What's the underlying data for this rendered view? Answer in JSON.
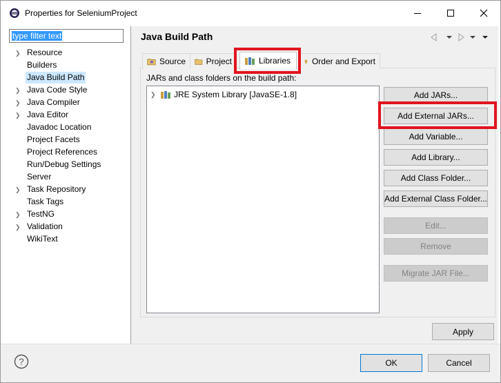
{
  "window": {
    "title": "Properties for SeleniumProject",
    "minimize_icon": "minimize-icon",
    "maximize_icon": "maximize-icon",
    "close_icon": "close-icon"
  },
  "filter": {
    "value": "type filter text"
  },
  "tree": {
    "items": [
      {
        "label": "Resource",
        "expandable": true
      },
      {
        "label": "Builders",
        "expandable": false
      },
      {
        "label": "Java Build Path",
        "expandable": false,
        "selected": true
      },
      {
        "label": "Java Code Style",
        "expandable": true
      },
      {
        "label": "Java Compiler",
        "expandable": true
      },
      {
        "label": "Java Editor",
        "expandable": true
      },
      {
        "label": "Javadoc Location",
        "expandable": false
      },
      {
        "label": "Project Facets",
        "expandable": false
      },
      {
        "label": "Project References",
        "expandable": false
      },
      {
        "label": "Run/Debug Settings",
        "expandable": false
      },
      {
        "label": "Server",
        "expandable": false
      },
      {
        "label": "Task Repository",
        "expandable": true
      },
      {
        "label": "Task Tags",
        "expandable": false
      },
      {
        "label": "TestNG",
        "expandable": true
      },
      {
        "label": "Validation",
        "expandable": true
      },
      {
        "label": "WikiText",
        "expandable": false
      }
    ]
  },
  "page": {
    "title": "Java Build Path"
  },
  "tabs": [
    {
      "label": "Source",
      "icon": "source-folder-icon"
    },
    {
      "label": "Project",
      "icon": "project-folder-icon"
    },
    {
      "label": "Libraries",
      "icon": "libraries-icon",
      "active": true
    },
    {
      "label": "Order and Export",
      "icon": "order-export-icon"
    }
  ],
  "libraries": {
    "section_label": "JARs and class folders on the build path:",
    "items": [
      {
        "label": "JRE System Library [JavaSE-1.8]"
      }
    ]
  },
  "buttons": {
    "add_jars": "Add JARs...",
    "add_external_jars": "Add External JARs...",
    "add_variable": "Add Variable...",
    "add_library": "Add Library...",
    "add_class_folder": "Add Class Folder...",
    "add_external_class_folder": "Add External Class Folder...",
    "edit": "Edit...",
    "remove": "Remove",
    "migrate_jar": "Migrate JAR File...",
    "apply": "Apply",
    "ok": "OK",
    "cancel": "Cancel"
  },
  "colors": {
    "highlight": "#e2141e",
    "selection": "#cce8ff",
    "accent": "#0078d7"
  }
}
